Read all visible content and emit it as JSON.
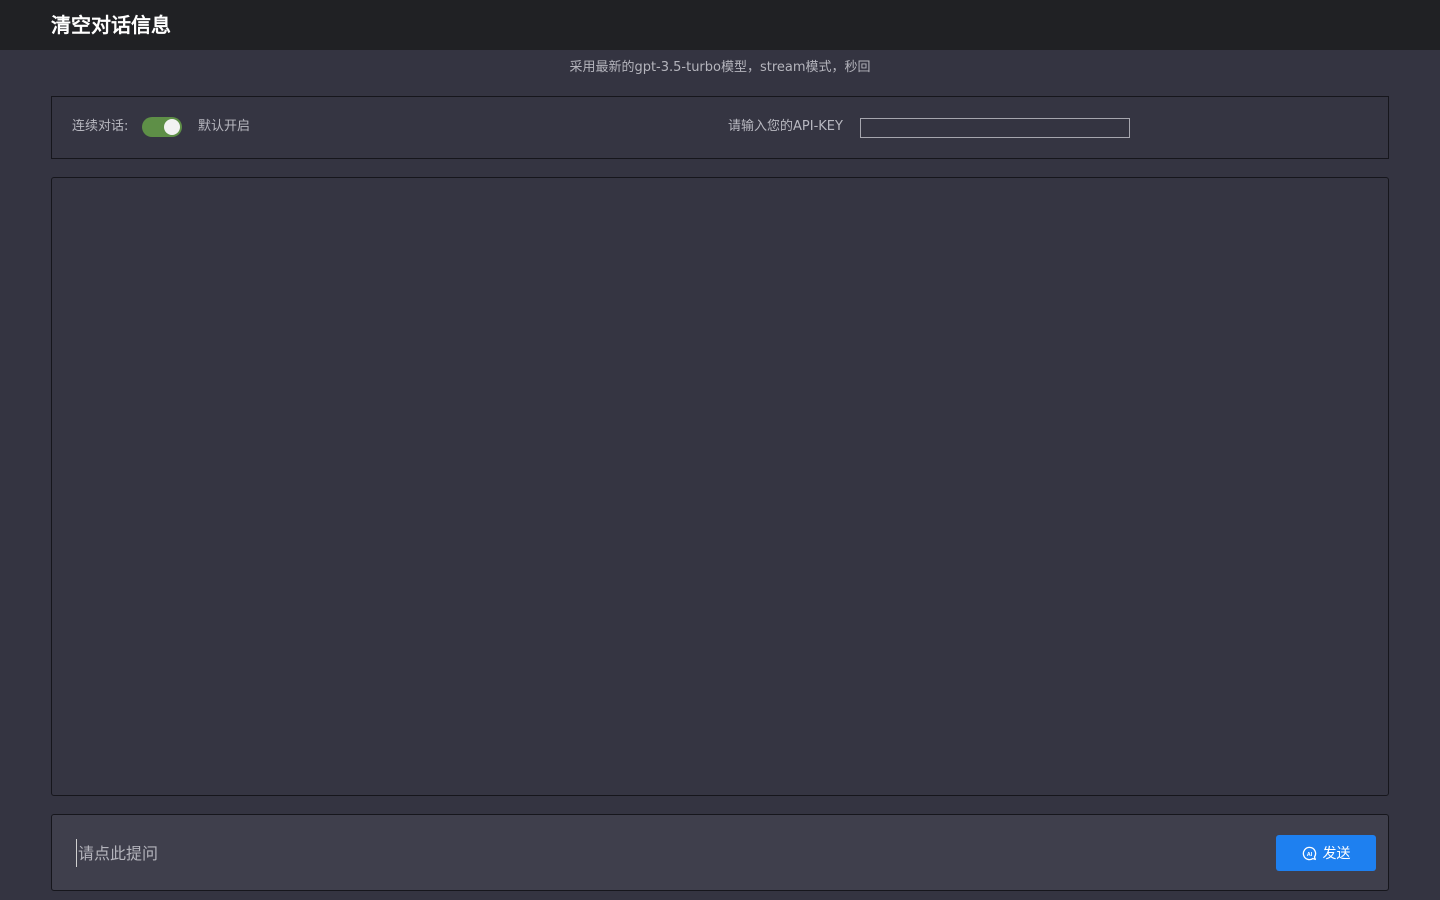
{
  "header": {
    "clear_label": "清空对话信息"
  },
  "subtitle": "采用最新的gpt-3.5-turbo模型，stream模式，秒回",
  "settings": {
    "continuous_label": "连续对话:",
    "continuous_enabled": true,
    "default_on_label": "默认开启",
    "api_key_label": "请输入您的API-KEY",
    "api_key_value": ""
  },
  "composer": {
    "placeholder": "请点此提问",
    "value": "",
    "send_label": "发送",
    "send_icon": "ai-chat-icon"
  },
  "colors": {
    "background": "#343441",
    "topbar": "#202124",
    "toggle_on": "#5e8f47",
    "send_button": "#1e80f0"
  }
}
